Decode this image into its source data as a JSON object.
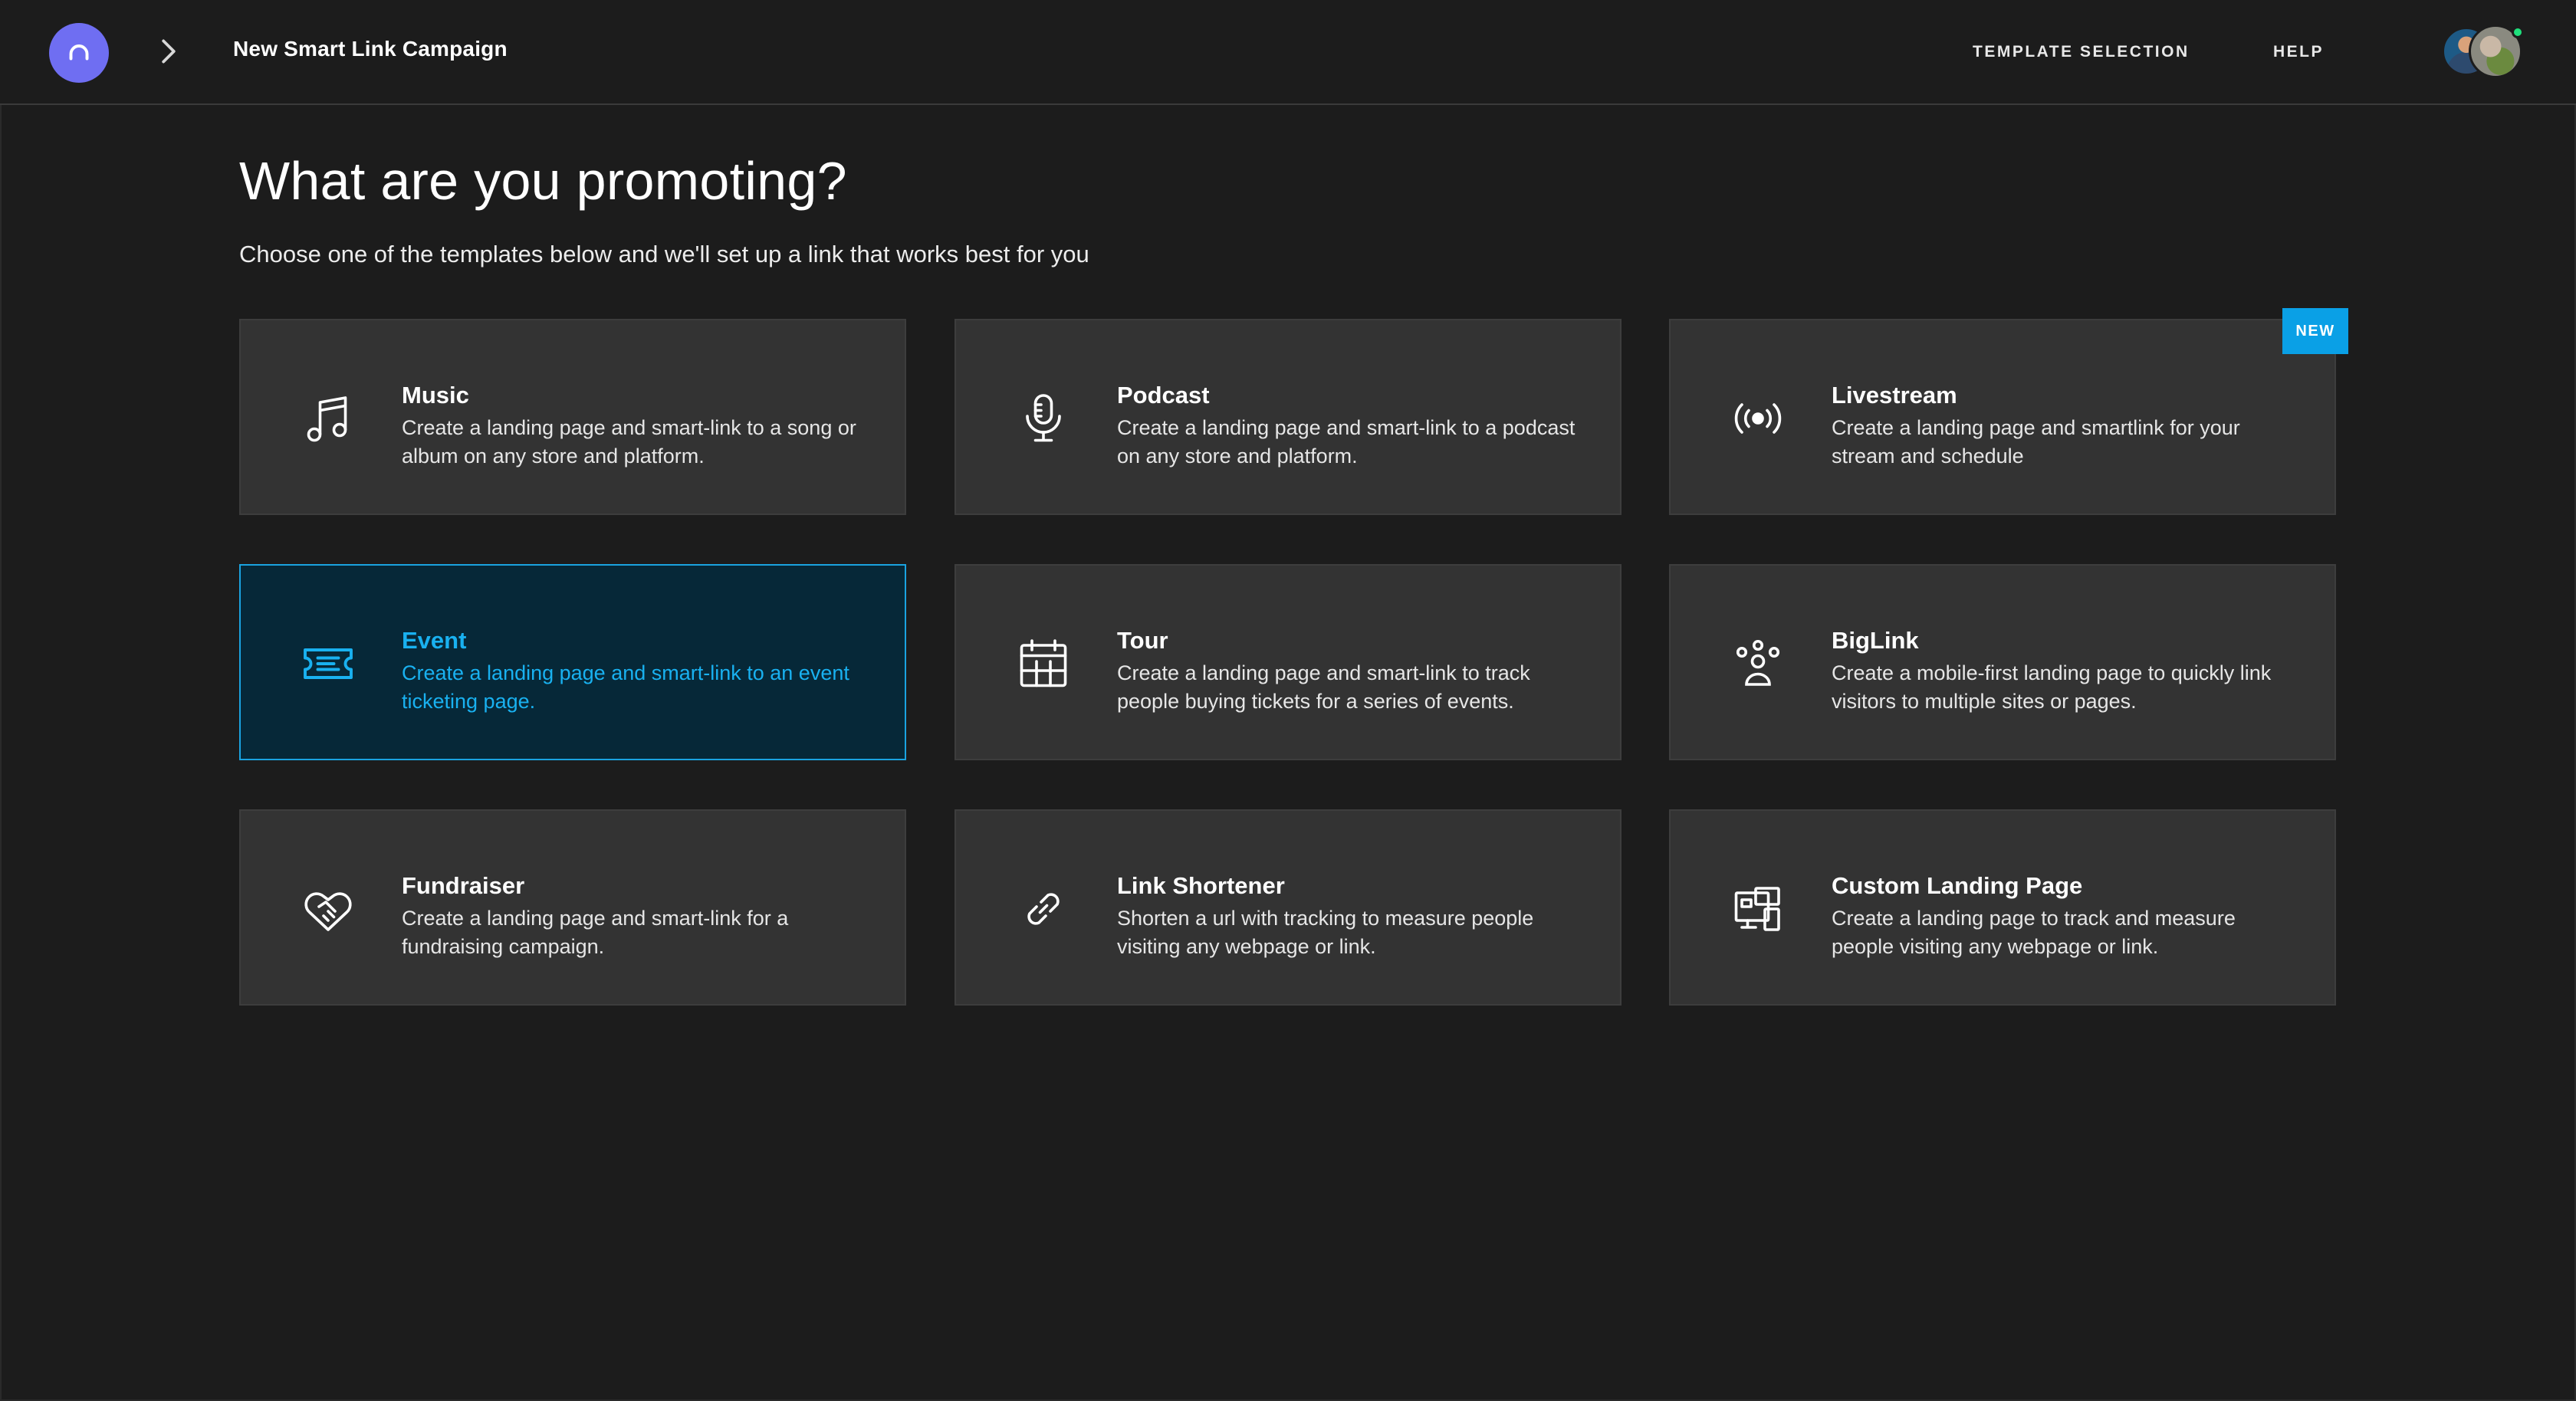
{
  "header": {
    "logo_icon": "headphones-logo-icon",
    "breadcrumb_separator_icon": "chevron-right-icon",
    "breadcrumb": "New Smart Link Campaign",
    "nav": {
      "template_selection": "TEMPLATE SELECTION",
      "help": "HELP"
    },
    "avatars": [
      "user-avatar-1",
      "user-avatar-2"
    ],
    "online_status_color": "#1fe07c"
  },
  "main": {
    "heading": "What are you promoting?",
    "subheading": "Choose one of the templates below and we'll set up a link that works best for you",
    "badge_new": "NEW",
    "templates": [
      {
        "title": "Music",
        "description": "Create a landing page and smart-link to a song or album on any store and platform.",
        "icon": "music-note-icon",
        "selected": false
      },
      {
        "title": "Podcast",
        "description": "Create a landing page and smart-link to a podcast on any store and platform.",
        "icon": "microphone-icon",
        "selected": false
      },
      {
        "title": "Livestream",
        "description": "Create a landing page and smartlink for your stream and schedule",
        "icon": "broadcast-icon",
        "selected": false,
        "badge": "NEW"
      },
      {
        "title": "Event",
        "description": "Create a landing page and smart-link to an event ticketing page.",
        "icon": "ticket-icon",
        "selected": true
      },
      {
        "title": "Tour",
        "description": "Create a landing page and smart-link to track people buying tickets for a series of events.",
        "icon": "calendar-icon",
        "selected": false
      },
      {
        "title": "BigLink",
        "description": "Create a mobile-first landing page to quickly link visitors to multiple sites or pages.",
        "icon": "people-group-icon",
        "selected": false
      },
      {
        "title": "Fundraiser",
        "description": "Create a landing page and smart-link for a fundraising campaign.",
        "icon": "handshake-heart-icon",
        "selected": false
      },
      {
        "title": "Link Shortener",
        "description": "Shorten a url with tracking to measure people visiting any webpage or link.",
        "icon": "link-icon",
        "selected": false
      },
      {
        "title": "Custom Landing Page",
        "description": "Create a landing page to track and measure people visiting any webpage or link.",
        "icon": "devices-icon",
        "selected": false
      }
    ]
  },
  "colors": {
    "background": "#1c1c1c",
    "card": "#333333",
    "selected_card_bg": "#062838",
    "accent": "#19b1f0",
    "logo": "#6f6ef2",
    "badge": "#0aa0e6"
  }
}
